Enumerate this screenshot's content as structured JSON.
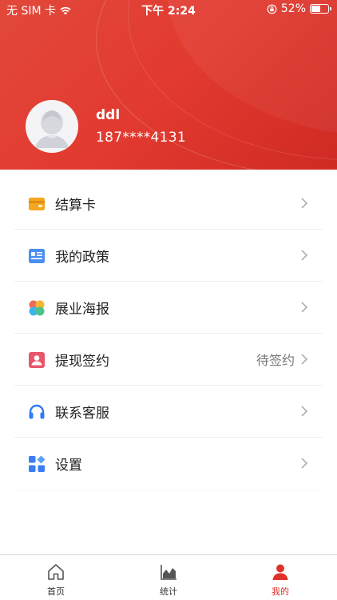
{
  "status_bar": {
    "carrier": "无 SIM 卡",
    "time": "下午 2:24",
    "battery": "52%",
    "battery_level": 0.52
  },
  "profile": {
    "username": "ddl",
    "phone": "187****4131"
  },
  "menu": {
    "items": [
      {
        "label": "结算卡",
        "icon": "card-icon",
        "status": ""
      },
      {
        "label": "我的政策",
        "icon": "policy-icon",
        "status": ""
      },
      {
        "label": "展业海报",
        "icon": "poster-icon",
        "status": ""
      },
      {
        "label": "提现签约",
        "icon": "contract-icon",
        "status": "待签约"
      },
      {
        "label": "联系客服",
        "icon": "headset-icon",
        "status": ""
      },
      {
        "label": "设置",
        "icon": "settings-icon",
        "status": ""
      }
    ]
  },
  "tabbar": {
    "tabs": [
      {
        "label": "首页",
        "icon": "home-icon",
        "active": false
      },
      {
        "label": "统计",
        "icon": "chart-icon",
        "active": false
      },
      {
        "label": "我的",
        "icon": "person-icon",
        "active": true
      }
    ]
  },
  "colors": {
    "header": "#e23a30",
    "accent": "#e0322b"
  }
}
